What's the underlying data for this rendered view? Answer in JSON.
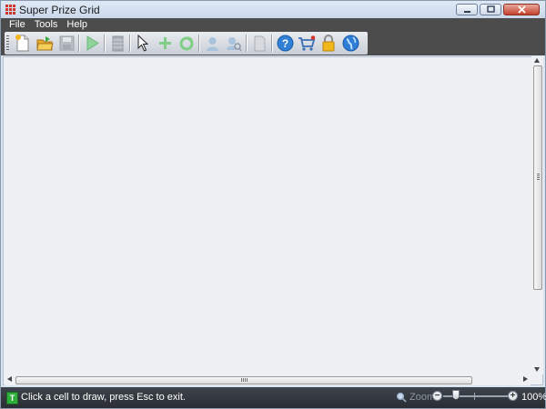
{
  "window": {
    "title": "Super Prize Grid"
  },
  "menu": {
    "items": [
      {
        "label": "File"
      },
      {
        "label": "Tools"
      },
      {
        "label": "Help"
      }
    ]
  },
  "toolbar": {
    "buttons": [
      {
        "icon": "new-document-icon",
        "enabled": true
      },
      {
        "icon": "open-folder-icon",
        "enabled": true
      },
      {
        "icon": "save-disk-icon",
        "enabled": false
      },
      {
        "icon": "play-icon",
        "enabled": false
      },
      {
        "icon": "stack-icon",
        "enabled": false
      },
      {
        "icon": "pointer-icon",
        "enabled": true
      },
      {
        "icon": "add-icon",
        "enabled": false
      },
      {
        "icon": "refresh-icon",
        "enabled": false
      },
      {
        "icon": "user-icon",
        "enabled": false
      },
      {
        "icon": "search-user-icon",
        "enabled": false
      },
      {
        "icon": "page-icon",
        "enabled": false
      },
      {
        "icon": "help-icon",
        "enabled": true
      },
      {
        "icon": "cart-icon",
        "enabled": true
      },
      {
        "icon": "lock-icon",
        "enabled": true
      },
      {
        "icon": "globe-icon",
        "enabled": true
      }
    ]
  },
  "status": {
    "icon": "T",
    "text": "Click a cell to draw, press Esc to exit."
  },
  "zoom": {
    "label": "Zoom",
    "value": "100%",
    "minus": "−",
    "plus": "+"
  },
  "colors": {
    "menubar": "#4c4c4c",
    "client": "#eff0f3",
    "accent_green": "#2fae3c"
  }
}
